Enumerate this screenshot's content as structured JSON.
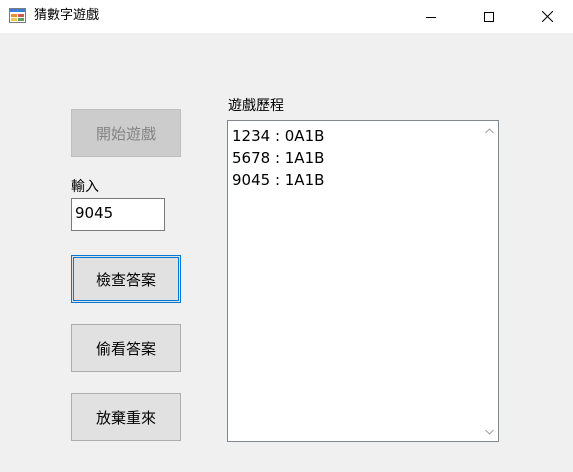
{
  "window": {
    "title": "猜數字遊戲",
    "app_icon": "windows-form-icon",
    "controls": [
      "minimize-icon",
      "maximize-icon",
      "close-icon"
    ]
  },
  "form": {
    "start_button": "開始遊戲",
    "input_label": "輸入",
    "input_value": "9045",
    "check_button": "檢查答案",
    "peek_button": "偷看答案",
    "giveup_button": "放棄重來",
    "history_label": "遊戲歷程",
    "history": [
      "1234 : 0A1B",
      "5678 : 1A1B",
      "9045 : 1A1B"
    ]
  },
  "colors": {
    "focus_border": "#0078d7",
    "button_face": "#e1e1e1",
    "disabled_face": "#cccccc",
    "window_bg": "#f0f0f0"
  }
}
